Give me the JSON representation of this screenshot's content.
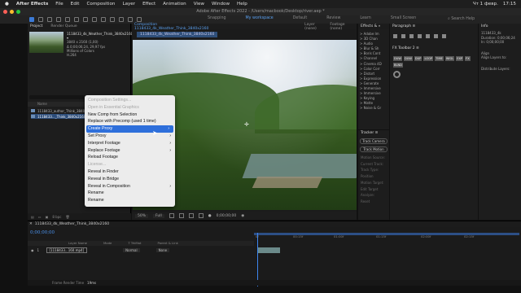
{
  "menubar": {
    "apple": "",
    "app": "After Effects",
    "items": [
      "File",
      "Edit",
      "Composition",
      "Layer",
      "Effect",
      "Animation",
      "View",
      "Window",
      "Help"
    ],
    "status": [
      "Чт 1 февр.",
      "17:15"
    ]
  },
  "titlebar": {
    "title": "Adobe After Effects 2022 - /Users/macbook/Desktop/river.aep *"
  },
  "workspaces": {
    "items": [
      "Snapping",
      "My workspace",
      "Default",
      "Review",
      "Learn",
      "Small Screen"
    ],
    "selected": "My workspace",
    "search": "Search Help"
  },
  "project": {
    "tabs": [
      "Project",
      "Render Queue"
    ],
    "file_name": "1118433_4k_Weather_Think_3840x2160.mp4 ▾",
    "file_info": [
      "3840 x 2160 (1,00)",
      "Δ 0;00;06;24, 29,97 fps",
      "Millions of Colors",
      "H.264"
    ],
    "headers": [
      "Name",
      "Type"
    ],
    "rows": [
      {
        "name": "1118433_author_Think_3840x2160",
        "type": "Composition",
        "selected": false
      },
      {
        "name": "1118433..._Think_3840x2160.mp4",
        "type": "QuickTime",
        "selected": true
      }
    ],
    "footer": "8 bpc"
  },
  "composition": {
    "tabs": [
      "Composition 1118433_4k_Weather_Think_3840x2160",
      "Layer (none)",
      "Footage (none)"
    ],
    "active_tab": "Composition 1118433_4k_Weather_Think_3840x2160",
    "subtab": "1118433_4k_Weather_Think_3840x2160",
    "zoom": "50%",
    "resolution": "Full",
    "timecode": "0;00;00;00"
  },
  "effects": {
    "title": "Effects & »",
    "items": [
      "> Adobe Im",
      "> 3D Chan",
      "> Audio",
      "> Blur & Sh",
      "> Boris Cont",
      "> Channel",
      "> Cinema 4D",
      "> Color Corr",
      "> Distort",
      "> Expression",
      "> Generate",
      "> Immersive",
      "> Immersive",
      "> Keying",
      "> Matte",
      "> Noise & Gr"
    ]
  },
  "tracker": {
    "title": "Tracker ≡",
    "buttons": [
      "Track Camera",
      "Track Motion"
    ],
    "lines": [
      "Motion Source:",
      "Current Track:",
      "Track Type:",
      "Position",
      "Motion Target:",
      "Edit Target",
      "Analyze:",
      "Reset"
    ]
  },
  "paragraph": {
    "title": "Paragraph ≡"
  },
  "fxtoolbar": {
    "title": "FX Toolbar 2 ≡",
    "buttons": [
      "DUW",
      "DUW",
      "DUP",
      "LOOP",
      "TIME",
      "WIGL",
      "EXP",
      "FX",
      "BLND"
    ]
  },
  "info": {
    "title": "Info",
    "lines": [
      "1118433_4k",
      "Duration: 0;00;06;24",
      "In: 0;00;00;00",
      "",
      "Align",
      "Align Layers to:",
      "",
      "Distribute Layers:"
    ]
  },
  "timeline": {
    "tab": "1118433_4k_Weather_Think_3840x2160",
    "time": "0;00;00;00",
    "headers": [
      "Layer Name",
      "Mode",
      "T TrkMat",
      "Parent & Link"
    ],
    "layer": {
      "num": "1",
      "name": "[1118433...160.mp4]",
      "mode": "Normal",
      "parent": "None"
    },
    "ruler": [
      "0f",
      "00:15f",
      "01:00f",
      "01:15f",
      "02:00f",
      "02:15f"
    ],
    "footer_label": "Frame Render Time",
    "footer_value": "19ms"
  },
  "context_menu": {
    "items": [
      {
        "label": "Composition Settings...",
        "disabled": true,
        "submenu": false,
        "highlight": false
      },
      {
        "label": "Open in Essential Graphics",
        "disabled": true,
        "submenu": false,
        "highlight": false
      },
      {
        "label": "New Comp from Selection",
        "disabled": false,
        "submenu": false,
        "highlight": false
      },
      {
        "label": "Replace with Precomp (used 1 time)",
        "disabled": false,
        "submenu": false,
        "highlight": false
      },
      {
        "label": "Create Proxy",
        "disabled": false,
        "submenu": true,
        "highlight": true
      },
      {
        "label": "Set Proxy",
        "disabled": false,
        "submenu": true,
        "highlight": false
      },
      {
        "label": "Interpret Footage",
        "disabled": false,
        "submenu": true,
        "highlight": false
      },
      {
        "label": "Replace Footage",
        "disabled": false,
        "submenu": true,
        "highlight": false
      },
      {
        "label": "Reload Footage",
        "disabled": false,
        "submenu": false,
        "highlight": false
      },
      {
        "label": "License...",
        "disabled": true,
        "submenu": false,
        "highlight": false
      },
      {
        "label": "Reveal in Finder",
        "disabled": false,
        "submenu": false,
        "highlight": false
      },
      {
        "label": "Reveal in Bridge",
        "disabled": false,
        "submenu": false,
        "highlight": false
      },
      {
        "label": "Reveal in Composition",
        "disabled": false,
        "submenu": true,
        "highlight": false
      },
      {
        "label": "Rename",
        "disabled": false,
        "submenu": false,
        "highlight": false
      },
      {
        "label": "Rename",
        "disabled": false,
        "submenu": false,
        "highlight": false
      }
    ]
  },
  "colors": {
    "accent": "#2e6fdb",
    "timecode": "#4a90e8",
    "selection": "#2d4d7a"
  }
}
